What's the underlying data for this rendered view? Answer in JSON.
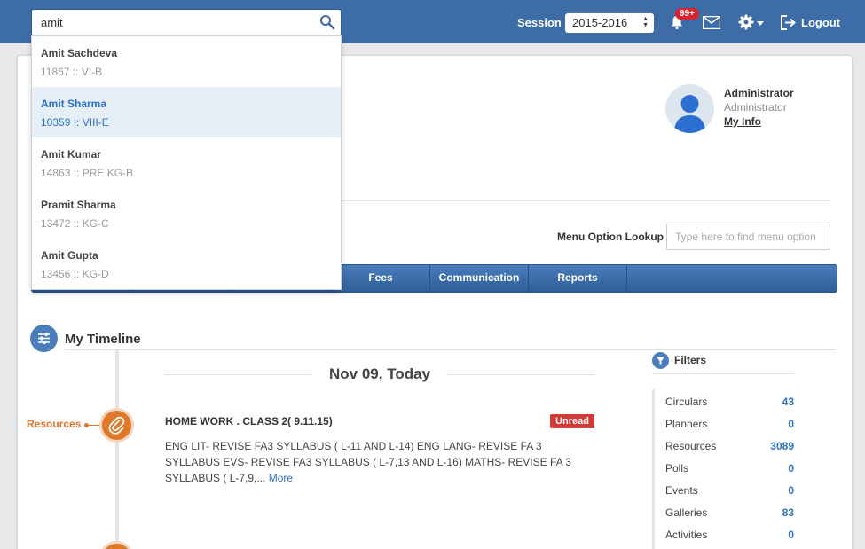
{
  "search": {
    "value": "amit"
  },
  "session": {
    "label": "Session",
    "selected": "2015-2016"
  },
  "notifications": {
    "badge": "99+"
  },
  "header": {
    "logout_label": "Logout"
  },
  "profile": {
    "name": "Administrator",
    "role": "Administrator",
    "link": "My Info"
  },
  "menu_lookup": {
    "label": "Menu Option Lookup",
    "placeholder": "Type here to find menu option"
  },
  "menu": {
    "items": [
      "Fees",
      "Communication",
      "Reports"
    ]
  },
  "dropdown": {
    "items": [
      {
        "name": "Amit Sachdeva",
        "sub": "11867 :: VI-B"
      },
      {
        "name": "Amit Sharma",
        "sub": "10359 :: VIII-E"
      },
      {
        "name": "Amit Kumar",
        "sub": "14863 :: PRE KG-B"
      },
      {
        "name": "Pramit Sharma",
        "sub": "13472 :: KG-C"
      },
      {
        "name": "Amit Gupta",
        "sub": "13456 :: KG-D"
      }
    ]
  },
  "timeline": {
    "title": "My Timeline",
    "date": "Nov 09, Today",
    "category": "Resources",
    "post_title": "HOME WORK . CLASS 2( 9.11.15)",
    "status": "Unread",
    "post_body": "ENG LIT- REVISE FA3 SYLLABUS ( L-11 AND L-14) ENG LANG- REVISE FA 3 SYLLABUS EVS- REVISE FA3 SYLLABUS ( L-7,13 AND L-16) MATHS- REVISE FA 3 SYLLABUS ( L-7,9,...",
    "more": "More"
  },
  "filters": {
    "title": "Filters",
    "items": [
      {
        "name": "Circulars",
        "count": "43"
      },
      {
        "name": "Planners",
        "count": "0"
      },
      {
        "name": "Resources",
        "count": "3089"
      },
      {
        "name": "Polls",
        "count": "0"
      },
      {
        "name": "Events",
        "count": "0"
      },
      {
        "name": "Galleries",
        "count": "83"
      },
      {
        "name": "Activities",
        "count": "0"
      }
    ]
  },
  "colors": {
    "header": "#3d6ca6",
    "accent": "#e0782b",
    "link": "#2a73c7",
    "unread": "#d23a37"
  }
}
